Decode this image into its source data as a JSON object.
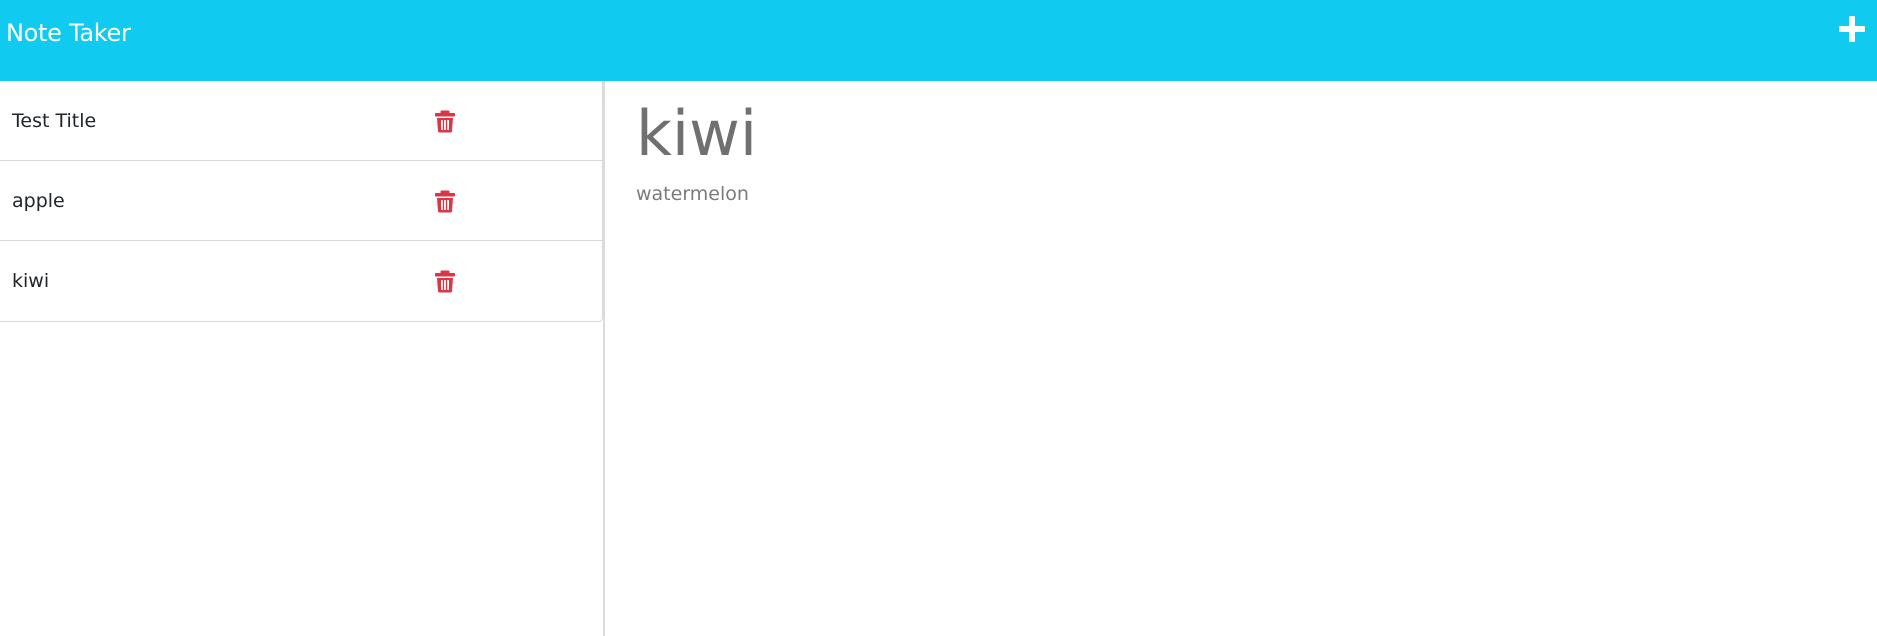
{
  "navbar": {
    "brand": "Note Taker",
    "new_note_icon": "plus-icon",
    "background_color": "#10cbef"
  },
  "notes": [
    {
      "title": "Test Title",
      "delete_icon": "trash-icon"
    },
    {
      "title": "apple",
      "delete_icon": "trash-icon"
    },
    {
      "title": "kiwi",
      "delete_icon": "trash-icon"
    }
  ],
  "active_note": {
    "title": "kiwi",
    "text": "watermelon"
  },
  "colors": {
    "delete": "#dc3545",
    "heading": "#707070",
    "body_text": "#7b7b7b"
  }
}
